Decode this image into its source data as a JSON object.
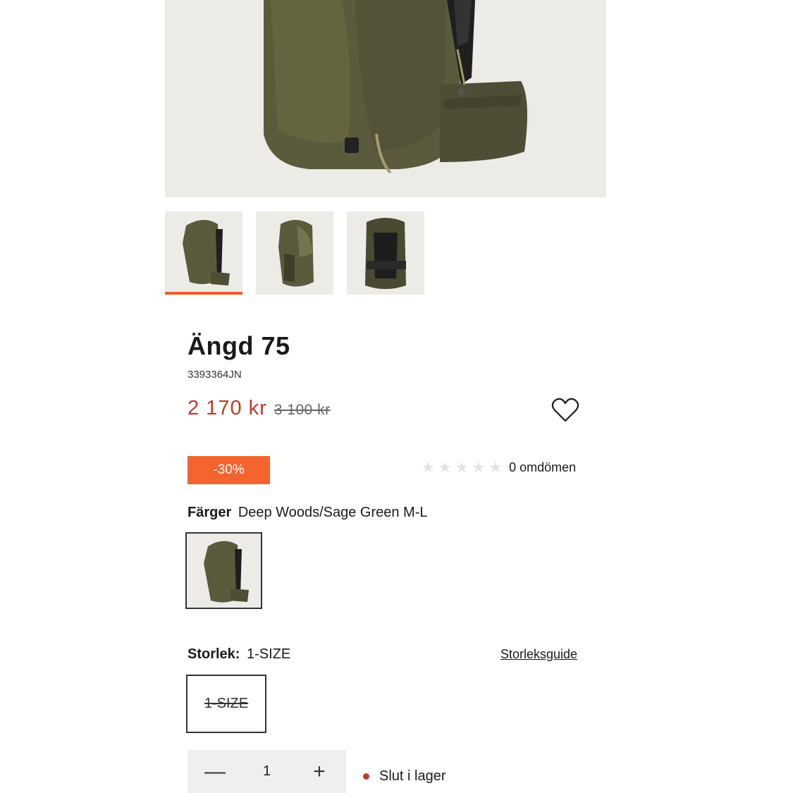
{
  "product": {
    "title": "Ängd 75",
    "sku": "3393364JN",
    "price_now": "2 170 kr",
    "price_old": "3 100 kr",
    "discount": "-30%"
  },
  "rating": {
    "score": 0,
    "max": 5,
    "text": "0 omdömen"
  },
  "colors": {
    "label": "Färger",
    "selected": "Deep Woods/Sage Green M-L"
  },
  "size": {
    "label": "Storlek:",
    "selected": "1-SIZE",
    "guide": "Storleksguide",
    "options": [
      "1-SIZE"
    ]
  },
  "quantity": {
    "minus": "—",
    "value": "1",
    "plus": "+"
  },
  "stock": {
    "text": "Slut i lager"
  },
  "theme": {
    "sale_color": "#c0392b",
    "badge_color": "#f4642f",
    "active_thumb_color": "#f05a2c",
    "bag_color": "#5a5a3a"
  },
  "icons": {
    "wishlist": "heart-outline-icon",
    "star": "star-icon"
  }
}
